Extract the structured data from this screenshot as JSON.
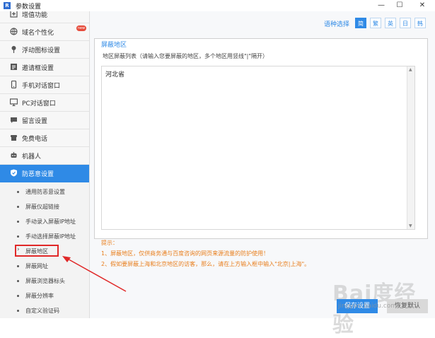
{
  "window": {
    "title": "参数设置",
    "app_icon": "R",
    "minimize": "—",
    "maximize": "☐",
    "close": "✕"
  },
  "sidebar": {
    "items": [
      {
        "label": "增值功能",
        "icon": "plus-icon"
      },
      {
        "label": "域名个性化",
        "icon": "globe-icon",
        "badge": "new"
      },
      {
        "label": "浮动图标设置",
        "icon": "pin-icon"
      },
      {
        "label": "邀请框设置",
        "icon": "dialog-icon"
      },
      {
        "label": "手机对话窗口",
        "icon": "phone-icon"
      },
      {
        "label": "PC对话窗口",
        "icon": "monitor-icon"
      },
      {
        "label": "留言设置",
        "icon": "message-icon"
      },
      {
        "label": "免费电话",
        "icon": "telephone-icon"
      },
      {
        "label": "机器人",
        "icon": "robot-icon"
      },
      {
        "label": "防恶意设置",
        "icon": "shield-icon",
        "active": true
      }
    ],
    "sub_items": [
      {
        "label": "通用防恶意设置"
      },
      {
        "label": "屏蔽仪超链接"
      },
      {
        "label": "手动录入屏蔽IP地址"
      },
      {
        "label": "手动选择屏蔽IP地址"
      },
      {
        "label": "屏蔽地区",
        "selected": true
      },
      {
        "label": "屏蔽网址"
      },
      {
        "label": "屏蔽浏览器标头"
      },
      {
        "label": "屏蔽分辨率"
      },
      {
        "label": "自定义验证码"
      }
    ]
  },
  "language": {
    "label": "语种选择",
    "options": [
      "简",
      "繁",
      "英",
      "日",
      "韩"
    ],
    "selected": "简"
  },
  "section": {
    "title": "屏蔽地区",
    "field_label": "地区屏蔽列表（请输入您要屏蔽的地区，多个地区用竖线\"|\"隔开）",
    "value": "河北省"
  },
  "tips": {
    "label": "提示：",
    "lines": [
      "1、屏蔽地区，仅供商务通与百度咨询的网页来源流量的防护使用！",
      "2、假如要屏蔽上海和北京地区的访客，那么，请在上方输入框中输入\"北京|上海\"。"
    ]
  },
  "buttons": {
    "save": "保存设置",
    "restore": "恢复默认"
  },
  "watermark": {
    "text": "Bai度经验",
    "url": "jingyan.baidu.com"
  },
  "colors": {
    "accent": "#2f8ae6",
    "tip": "#e87e1c",
    "highlight": "#e02828"
  }
}
